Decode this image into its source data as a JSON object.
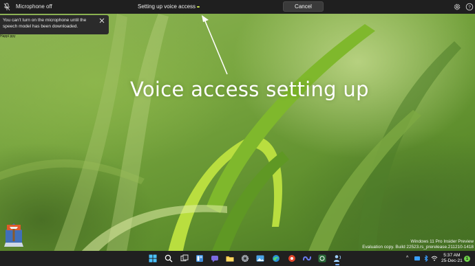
{
  "voice_access_bar": {
    "mic_icon": "microphone-off-icon",
    "mic_state": "Microphone off",
    "status": "Setting up voice access",
    "cancel_label": "Cancel",
    "settings_icon": "gear-icon",
    "help_icon": "help-icon"
  },
  "toast": {
    "message": "You can't turn on the microphone until the speech model has been downloaded.",
    "close_icon": "close-icon",
    "cut_text": "Happi ppy"
  },
  "overlay": {
    "caption": "Voice access setting up"
  },
  "watermark": {
    "line1": "Windows 11 Pro Insider Preview",
    "line2": "Evaluation copy. Build 22523.rs_prerelease.211210-1418"
  },
  "taskbar": {
    "icons": [
      "windows-start-icon",
      "search-icon",
      "task-view-icon",
      "widgets-icon",
      "chat-icon",
      "file-explorer-icon",
      "settings-app-icon",
      "photos-icon",
      "edge-icon",
      "office-icon",
      "copilot-icon",
      "xbox-icon",
      "voice-access-icon"
    ],
    "tray_chevron": "^",
    "tray_icons": [
      "network-icon",
      "bluetooth-icon",
      "wifi-icon",
      "volume-icon"
    ],
    "time": "5:37 AM",
    "date": "25-Dec-21",
    "notification_count": "1"
  },
  "colors": {
    "bar_bg": "#1f1f1f",
    "taskbar_bg": "#202020",
    "accent": "#c9e34a"
  }
}
